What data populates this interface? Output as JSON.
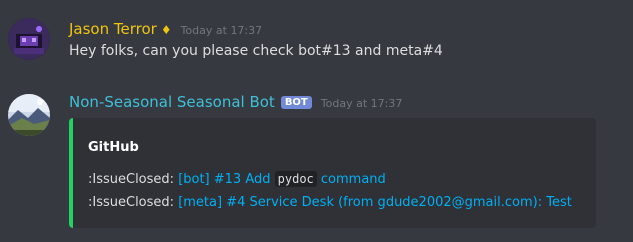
{
  "messages": [
    {
      "username": "Jason Terror",
      "badge_glyph": "♦",
      "timestamp": "Today at 17:37",
      "content": "Hey folks, can you please check bot#13 and meta#4",
      "name_color": "#f1c40f"
    },
    {
      "username": "Non-Seasonal Seasonal Bot",
      "bot_tag": "BOT",
      "timestamp": "Today at 17:37",
      "name_color": "#3ec0d8",
      "embed": {
        "accent_color": "#21d35c",
        "title": "GitHub",
        "lines": [
          {
            "prefix": ":IssueClosed: ",
            "link_before_code": "[bot] #13 Add ",
            "code": "pydoc",
            "link_after_code": " command"
          },
          {
            "prefix": ":IssueClosed: ",
            "link": "[meta] #4 Service Desk (from gdude2002@gmail.com): Test"
          }
        ]
      }
    }
  ],
  "icons": {
    "avatar1": "user-avatar-purple-neon",
    "avatar2": "bot-avatar-landscape"
  }
}
